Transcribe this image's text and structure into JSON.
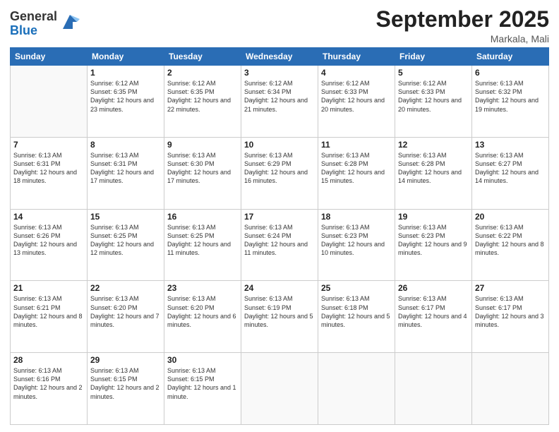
{
  "logo": {
    "general": "General",
    "blue": "Blue"
  },
  "title": {
    "month": "September 2025",
    "location": "Markala, Mali"
  },
  "headers": [
    "Sunday",
    "Monday",
    "Tuesday",
    "Wednesday",
    "Thursday",
    "Friday",
    "Saturday"
  ],
  "weeks": [
    [
      {
        "day": "",
        "info": ""
      },
      {
        "day": "1",
        "info": "Sunrise: 6:12 AM\nSunset: 6:35 PM\nDaylight: 12 hours\nand 23 minutes."
      },
      {
        "day": "2",
        "info": "Sunrise: 6:12 AM\nSunset: 6:35 PM\nDaylight: 12 hours\nand 22 minutes."
      },
      {
        "day": "3",
        "info": "Sunrise: 6:12 AM\nSunset: 6:34 PM\nDaylight: 12 hours\nand 21 minutes."
      },
      {
        "day": "4",
        "info": "Sunrise: 6:12 AM\nSunset: 6:33 PM\nDaylight: 12 hours\nand 20 minutes."
      },
      {
        "day": "5",
        "info": "Sunrise: 6:12 AM\nSunset: 6:33 PM\nDaylight: 12 hours\nand 20 minutes."
      },
      {
        "day": "6",
        "info": "Sunrise: 6:13 AM\nSunset: 6:32 PM\nDaylight: 12 hours\nand 19 minutes."
      }
    ],
    [
      {
        "day": "7",
        "info": "Sunrise: 6:13 AM\nSunset: 6:31 PM\nDaylight: 12 hours\nand 18 minutes."
      },
      {
        "day": "8",
        "info": "Sunrise: 6:13 AM\nSunset: 6:31 PM\nDaylight: 12 hours\nand 17 minutes."
      },
      {
        "day": "9",
        "info": "Sunrise: 6:13 AM\nSunset: 6:30 PM\nDaylight: 12 hours\nand 17 minutes."
      },
      {
        "day": "10",
        "info": "Sunrise: 6:13 AM\nSunset: 6:29 PM\nDaylight: 12 hours\nand 16 minutes."
      },
      {
        "day": "11",
        "info": "Sunrise: 6:13 AM\nSunset: 6:28 PM\nDaylight: 12 hours\nand 15 minutes."
      },
      {
        "day": "12",
        "info": "Sunrise: 6:13 AM\nSunset: 6:28 PM\nDaylight: 12 hours\nand 14 minutes."
      },
      {
        "day": "13",
        "info": "Sunrise: 6:13 AM\nSunset: 6:27 PM\nDaylight: 12 hours\nand 14 minutes."
      }
    ],
    [
      {
        "day": "14",
        "info": "Sunrise: 6:13 AM\nSunset: 6:26 PM\nDaylight: 12 hours\nand 13 minutes."
      },
      {
        "day": "15",
        "info": "Sunrise: 6:13 AM\nSunset: 6:25 PM\nDaylight: 12 hours\nand 12 minutes."
      },
      {
        "day": "16",
        "info": "Sunrise: 6:13 AM\nSunset: 6:25 PM\nDaylight: 12 hours\nand 11 minutes."
      },
      {
        "day": "17",
        "info": "Sunrise: 6:13 AM\nSunset: 6:24 PM\nDaylight: 12 hours\nand 11 minutes."
      },
      {
        "day": "18",
        "info": "Sunrise: 6:13 AM\nSunset: 6:23 PM\nDaylight: 12 hours\nand 10 minutes."
      },
      {
        "day": "19",
        "info": "Sunrise: 6:13 AM\nSunset: 6:23 PM\nDaylight: 12 hours\nand 9 minutes."
      },
      {
        "day": "20",
        "info": "Sunrise: 6:13 AM\nSunset: 6:22 PM\nDaylight: 12 hours\nand 8 minutes."
      }
    ],
    [
      {
        "day": "21",
        "info": "Sunrise: 6:13 AM\nSunset: 6:21 PM\nDaylight: 12 hours\nand 8 minutes."
      },
      {
        "day": "22",
        "info": "Sunrise: 6:13 AM\nSunset: 6:20 PM\nDaylight: 12 hours\nand 7 minutes."
      },
      {
        "day": "23",
        "info": "Sunrise: 6:13 AM\nSunset: 6:20 PM\nDaylight: 12 hours\nand 6 minutes."
      },
      {
        "day": "24",
        "info": "Sunrise: 6:13 AM\nSunset: 6:19 PM\nDaylight: 12 hours\nand 5 minutes."
      },
      {
        "day": "25",
        "info": "Sunrise: 6:13 AM\nSunset: 6:18 PM\nDaylight: 12 hours\nand 5 minutes."
      },
      {
        "day": "26",
        "info": "Sunrise: 6:13 AM\nSunset: 6:17 PM\nDaylight: 12 hours\nand 4 minutes."
      },
      {
        "day": "27",
        "info": "Sunrise: 6:13 AM\nSunset: 6:17 PM\nDaylight: 12 hours\nand 3 minutes."
      }
    ],
    [
      {
        "day": "28",
        "info": "Sunrise: 6:13 AM\nSunset: 6:16 PM\nDaylight: 12 hours\nand 2 minutes."
      },
      {
        "day": "29",
        "info": "Sunrise: 6:13 AM\nSunset: 6:15 PM\nDaylight: 12 hours\nand 2 minutes."
      },
      {
        "day": "30",
        "info": "Sunrise: 6:13 AM\nSunset: 6:15 PM\nDaylight: 12 hours\nand 1 minute."
      },
      {
        "day": "",
        "info": ""
      },
      {
        "day": "",
        "info": ""
      },
      {
        "day": "",
        "info": ""
      },
      {
        "day": "",
        "info": ""
      }
    ]
  ]
}
